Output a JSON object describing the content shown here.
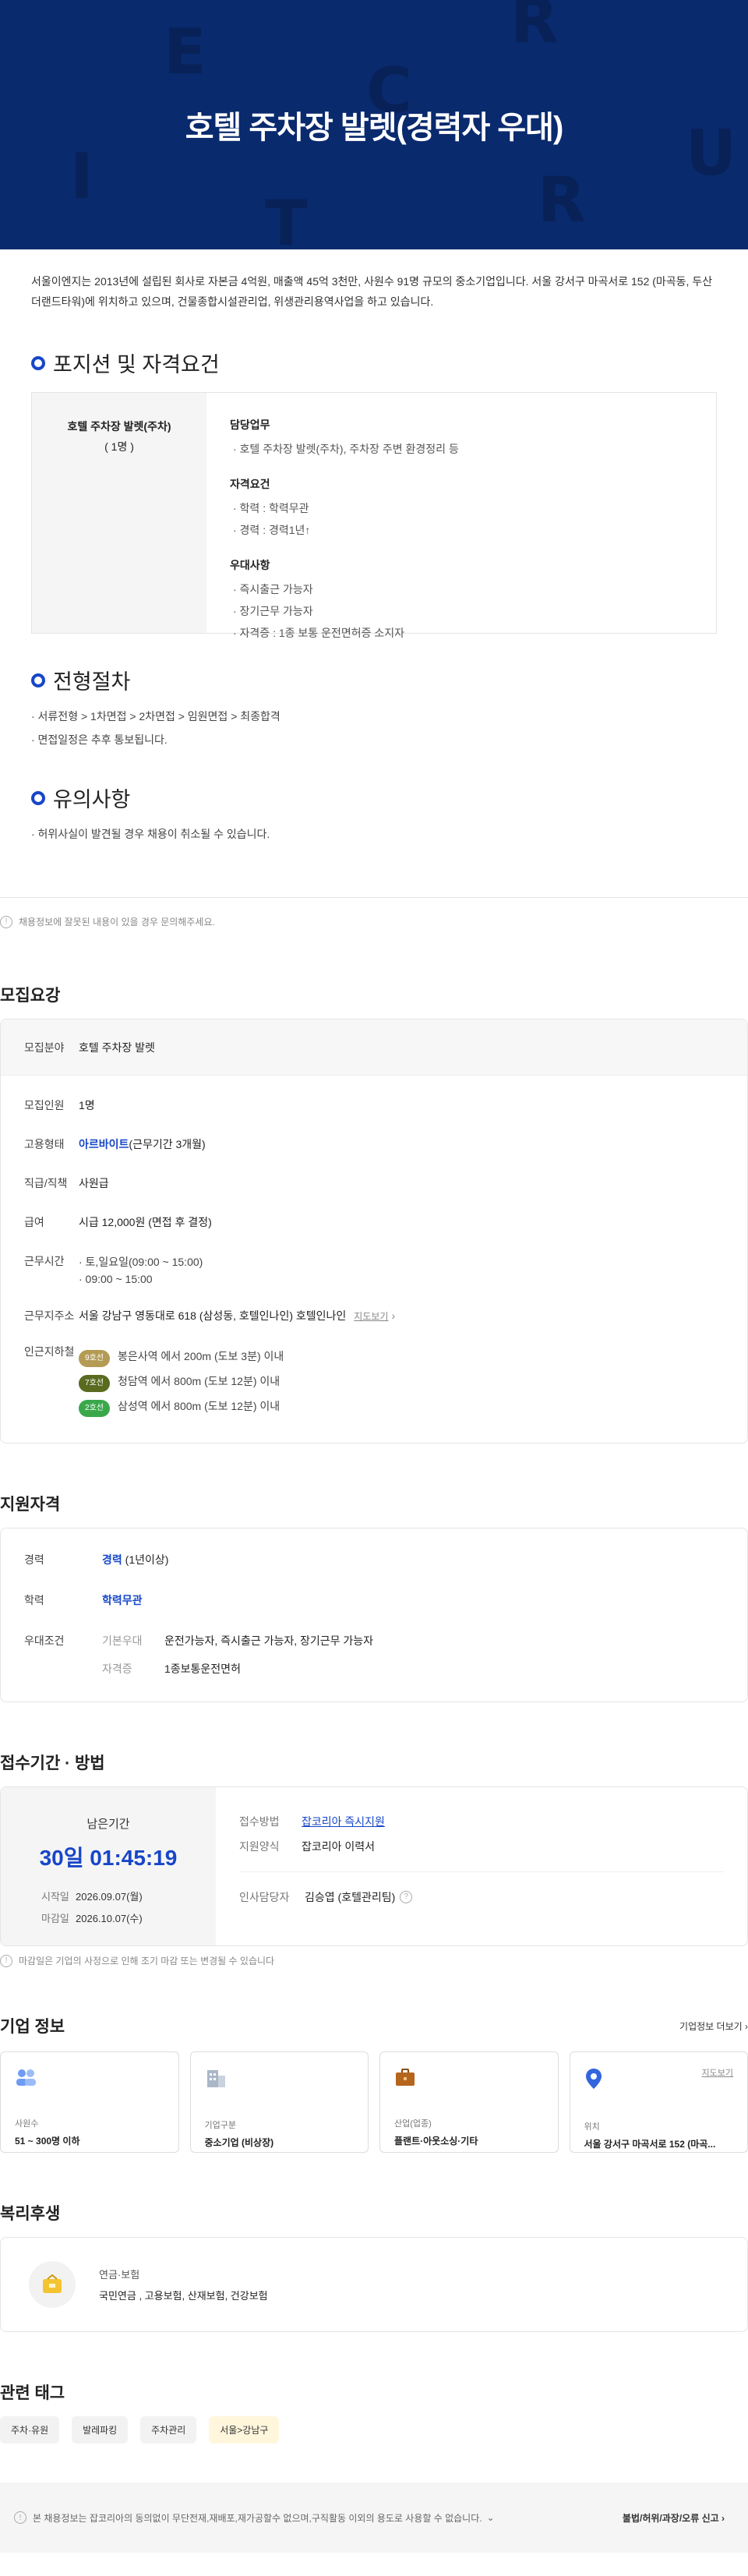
{
  "hero": {
    "title": "호텔 주차장 발렛(경력자 우대)",
    "bg_letters": [
      "E",
      "R",
      "C",
      "I",
      "T",
      "R",
      "U",
      "C"
    ]
  },
  "intro": "서울이엔지는 2013년에 설립된 회사로 자본금 4억원, 매출액 45억 3천만, 사원수 91명 규모의 중소기업입니다. 서울 강서구 마곡서로 152 (마곡동, 두산더랜드타워)에 위치하고 있으며, 건물종합시설관리업, 위생관리용역사업을 하고 있습니다.",
  "position_section": {
    "title": "포지션 및 자격요건",
    "position_name": "호텔 주차장 발렛(주차)",
    "headcount": "( 1명 )",
    "groups": [
      {
        "title": "담당업무",
        "items": [
          "· 호텔 주차장 발렛(주차), 주차장 주변 환경정리 등"
        ]
      },
      {
        "title": "자격요건",
        "items": [
          "· 학력 : 학력무관",
          "· 경력 : 경력1년↑"
        ]
      },
      {
        "title": "우대사항",
        "items": [
          "· 즉시출근 가능자",
          "· 장기근무 가능자",
          "· 자격증 : 1종 보통 운전면허증 소지자"
        ]
      }
    ]
  },
  "process_section": {
    "title": "전형절차",
    "items": [
      "· 서류전형 > 1차면접 > 2차면접 > 임원면접 > 최종합격",
      "· 면접일정은 추후 통보됩니다."
    ]
  },
  "notes_section": {
    "title": "유의사항",
    "items": [
      "· 허위사실이 발견될 경우 채용이 취소될 수 있습니다."
    ]
  },
  "report_note": "채용정보에 잘못된 내용이 있을 경우 문의해주세요.",
  "recruit": {
    "title": "모집요강",
    "field_key": "모집분야",
    "field_value": "호텔 주차장 발렛",
    "rows": {
      "headcount_k": "모집인원",
      "headcount_v": "1명",
      "type_k": "고용형태",
      "type_v1": "아르바이트",
      "type_v2": "(근무기간 3개월)",
      "rank_k": "직급/직책",
      "rank_v": "사원급",
      "pay_k": "급여",
      "pay_v": "시급 12,000원 (면접 후 결정)",
      "hours_k": "근무시간",
      "hours_v1": "· 토,일요일(09:00 ~ 15:00)",
      "hours_v2": "· 09:00 ~ 15:00",
      "addr_k": "근무지주소",
      "addr_v": "서울 강남구 영동대로 618 (삼성동, 호텔인나인) 호텔인나인",
      "map": "지도보기",
      "subway_k": "인근지하철"
    },
    "subway": [
      {
        "line": "9호선",
        "color": "#b49b54",
        "text": "봉은사역 에서 200m (도보 3분) 이내"
      },
      {
        "line": "7호선",
        "color": "#5a6b1f",
        "text": "청담역 에서 800m (도보 12분) 이내"
      },
      {
        "line": "2호선",
        "color": "#3aa84a",
        "text": "삼성역 에서 800m (도보 12분) 이내"
      }
    ]
  },
  "qualification": {
    "title": "지원자격",
    "career_k": "경력",
    "career_v1": "경력",
    "career_v2": "(1년이상)",
    "edu_k": "학력",
    "edu_v": "학력무관",
    "pref_k": "우대조건",
    "pref_sub1_k": "기본우대",
    "pref_sub1_v": "운전가능자, 즉시출근 가능자, 장기근무 가능자",
    "pref_sub2_k": "자격증",
    "pref_sub2_v": "1종보통운전면허"
  },
  "period": {
    "title": "접수기간 · 방법",
    "remaining_label": "남은기간",
    "remaining_time": "30일 01:45:19",
    "start_k": "시작일",
    "start_v": "2026.09.07(월)",
    "end_k": "마감일",
    "end_v": "2026.10.07(수)",
    "method_k": "접수방법",
    "method_v": "잡코리아 즉시지원",
    "form_k": "지원양식",
    "form_v": "잡코리아 이력서",
    "hr_k": "인사담당자",
    "hr_v": "김승엽 (호텔관리팀)",
    "note": "마감일은 기업의 사정으로 인해 조기 마감 또는 변경될 수 있습니다"
  },
  "company": {
    "title": "기업 정보",
    "more": "기업정보 더보기",
    "cards": [
      {
        "icon": "people-icon",
        "label": "사원수",
        "value": "51 ~ 300명 이하",
        "color": "#5b8def"
      },
      {
        "icon": "building-icon",
        "label": "기업구분",
        "value": "중소기업 (비상장)",
        "color": "#8a9bb0"
      },
      {
        "icon": "briefcase-icon",
        "label": "산업(업종)",
        "value": "플랜트·아웃소싱·기타",
        "color": "#b5651d"
      },
      {
        "icon": "location-pin-icon",
        "label": "위치",
        "value": "서울 강서구 마곡서로 152 (마곡...",
        "color": "#3366dd",
        "map": "지도보기"
      }
    ]
  },
  "welfare": {
    "title": "복리후생",
    "category": "연금·보험",
    "items": "국민연금 , 고용보험, 산재보험, 건강보험"
  },
  "tags": {
    "title": "관련 태그",
    "items": [
      "주차·유원",
      "발레파킹",
      "주차관리",
      "서울>강남구"
    ]
  },
  "footer": {
    "notice": "본 채용정보는 잡코리아의 동의없이 무단전재,재배포,재가공할수 없으며,구직활동 이외의 용도로 사용할 수 없습니다.",
    "report": "불법/허위/과장/오류 신고"
  }
}
